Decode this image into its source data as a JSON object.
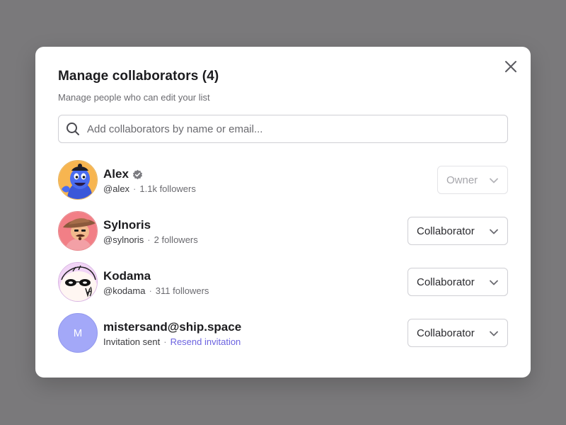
{
  "modal": {
    "title": "Manage collaborators (4)",
    "subtitle": "Manage people who can edit your list"
  },
  "search": {
    "placeholder": "Add collaborators by name or email..."
  },
  "collaborators": [
    {
      "name": "Alex",
      "verified": true,
      "handle": "@alex",
      "followers": "1.1k followers",
      "role": "Owner",
      "role_disabled": true
    },
    {
      "name": "Sylnoris",
      "handle": "@sylnoris",
      "followers": "2 followers",
      "role": "Collaborator"
    },
    {
      "name": "Kodama",
      "handle": "@kodama",
      "followers": "311 followers",
      "role": "Collaborator"
    },
    {
      "name": "mistersand@ship.space",
      "avatar_initial": "M",
      "status": "Invitation sent",
      "action": "Resend invitation",
      "role": "Collaborator"
    }
  ],
  "icons": {
    "close": "close-icon",
    "search": "search-icon",
    "verified": "verified-badge-icon",
    "chevron": "chevron-down-icon"
  },
  "colors": {
    "overlay": "#7a797b",
    "link": "#6c63e0",
    "initial_avatar_bg": "#a3a8f8"
  }
}
